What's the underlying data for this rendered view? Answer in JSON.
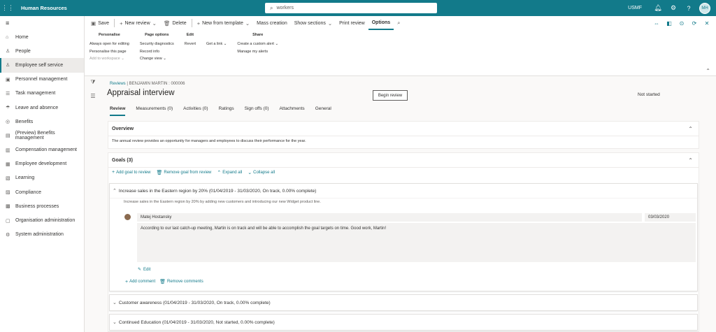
{
  "topbar": {
    "app_title": "Human Resources",
    "search_value": "workers",
    "company": "USMF",
    "avatar_initials": "MH"
  },
  "nav": {
    "items": [
      {
        "label": "Home",
        "icon": "home-icon"
      },
      {
        "label": "People",
        "icon": "people-icon"
      },
      {
        "label": "Employee self service",
        "icon": "self-service-icon"
      },
      {
        "label": "Personnel management",
        "icon": "personnel-icon"
      },
      {
        "label": "Task management",
        "icon": "task-icon"
      },
      {
        "label": "Leave and absence",
        "icon": "leave-icon"
      },
      {
        "label": "Benefits",
        "icon": "benefits-icon"
      },
      {
        "label": "(Preview) Benefits management",
        "icon": "benefits-mgmt-icon"
      },
      {
        "label": "Compensation management",
        "icon": "compensation-icon"
      },
      {
        "label": "Employee development",
        "icon": "development-icon"
      },
      {
        "label": "Learning",
        "icon": "learning-icon"
      },
      {
        "label": "Compliance",
        "icon": "compliance-icon"
      },
      {
        "label": "Business processes",
        "icon": "process-icon"
      },
      {
        "label": "Organisation administration",
        "icon": "org-icon"
      },
      {
        "label": "System administration",
        "icon": "system-icon"
      }
    ]
  },
  "toolbar": {
    "save": "Save",
    "new_review": "New review",
    "delete": "Delete",
    "new_from_template": "New from template",
    "mass_creation": "Mass creation",
    "show_sections": "Show sections",
    "print_review": "Print review",
    "options": "Options"
  },
  "ribbon": {
    "personalise": {
      "title": "Personalise",
      "items": [
        "Always open for editing",
        "Personalise this page",
        "Add to workspace"
      ]
    },
    "page_options": {
      "title": "Page options",
      "items": [
        "Security diagnostics",
        "Record info",
        "Change view"
      ]
    },
    "edit": {
      "title": "Edit",
      "items": [
        "Revert"
      ]
    },
    "share": {
      "title": "Share",
      "get_link": "Get a link",
      "items": [
        "Create a custom alert",
        "Manage my alerts"
      ]
    }
  },
  "page": {
    "breadcrumb_link": "Reviews",
    "breadcrumb_record": "BENJAMIN MARTIN : 000006",
    "title": "Appraisal interview",
    "begin_review": "Begin review",
    "status": "Not started",
    "tabs": [
      "Review",
      "Measurements (0)",
      "Activities (0)",
      "Ratings",
      "Sign offs (0)",
      "Attachments",
      "General"
    ]
  },
  "overview": {
    "title": "Overview",
    "text": "The annual review provides an opportunity for managers and employees to discuss their performance for the year."
  },
  "goals": {
    "title": "Goals (3)",
    "add_goal": "Add goal to review",
    "remove_goal": "Remove goal from review",
    "expand_all": "Expand all",
    "collapse_all": "Collapse all",
    "goal1": {
      "header": "Increase sales in the Eastern region by 20% (01/04/2019 - 31/03/2020, On track, 0.00% complete)",
      "description": "Increase sales in the Eastern region by 20% by adding new customers and introducing our new Widget product line.",
      "commenter": "Matej Hostansky",
      "date": "03/03/2020",
      "comment": "According to our last catch-up meeting, Martin is on track and will be able to accomplish the goal targets on time. Good work, Martin!",
      "edit": "Edit",
      "add_comment": "Add comment",
      "remove_comments": "Remove comments"
    },
    "goal2": "Customer awareness (01/04/2019 - 31/03/2020, On track, 0.00% complete)",
    "goal3": "Continued Education (01/04/2019 - 31/03/2020, Not started, 0.00% complete)"
  }
}
